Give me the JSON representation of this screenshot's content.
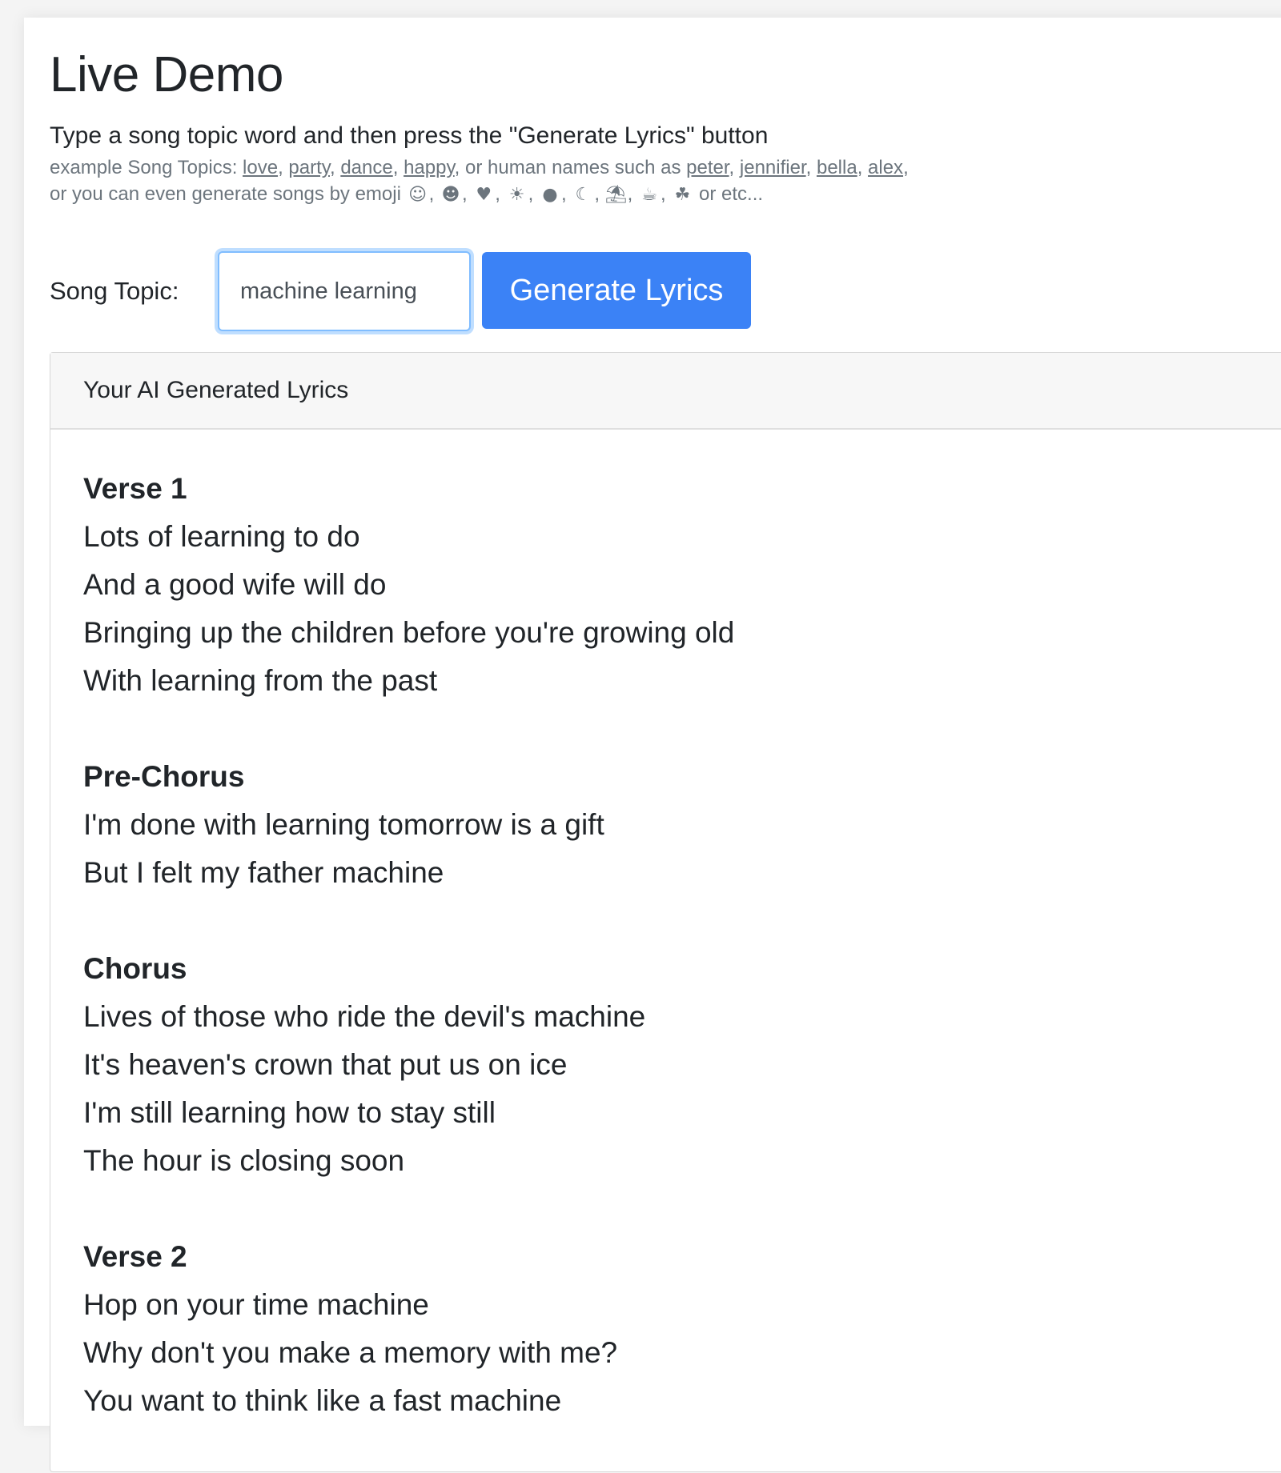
{
  "page_title": "Live Demo",
  "instruction": "Type a song topic word and then press the \"Generate Lyrics\" button",
  "examples": {
    "prefix": "example Song Topics: ",
    "topics": [
      "love",
      "party",
      "dance",
      "happy"
    ],
    "names_prefix": "or human names such as ",
    "names": [
      "peter",
      "jennifier",
      "bella",
      "alex"
    ],
    "emoji_prefix": "or you can even generate songs by emoji ",
    "emojis": [
      {
        "name": "smiling-face-icon",
        "glyph": "☺"
      },
      {
        "name": "sunglasses-face-icon",
        "glyph": "☻"
      },
      {
        "name": "heart-icon",
        "glyph": "♥"
      },
      {
        "name": "sun-icon",
        "glyph": "☀"
      },
      {
        "name": "poop-icon",
        "glyph": "●"
      },
      {
        "name": "banana-icon",
        "glyph": "☾"
      },
      {
        "name": "beach-island-icon",
        "glyph": "⛱"
      },
      {
        "name": "beer-mug-icon",
        "glyph": "☕"
      },
      {
        "name": "four-leaf-clover-icon",
        "glyph": "☘"
      }
    ],
    "suffix": " or etc..."
  },
  "form": {
    "label": "Song Topic:",
    "input_value": "machine learning",
    "button_label": "Generate Lyrics"
  },
  "colors": {
    "accent": "#3b82f6",
    "muted_text": "#6c757d"
  },
  "lyrics_card": {
    "header": "Your AI Generated Lyrics",
    "sections": [
      {
        "title": "Verse 1",
        "lines": [
          "Lots of learning to do",
          "And a good wife will do",
          "Bringing up the children before you're growing old",
          "With learning from the past"
        ]
      },
      {
        "title": "Pre-Chorus",
        "lines": [
          "I'm done with learning tomorrow is a gift",
          "But I felt my father machine"
        ]
      },
      {
        "title": "Chorus",
        "lines": [
          "Lives of those who ride the devil's machine",
          "It's heaven's crown that put us on ice",
          "I'm still learning how to stay still",
          "The hour is closing soon"
        ]
      },
      {
        "title": "Verse 2",
        "lines": [
          "Hop on your time machine",
          "Why don't you make a memory with me?",
          "You want to think like a fast machine"
        ]
      }
    ]
  }
}
